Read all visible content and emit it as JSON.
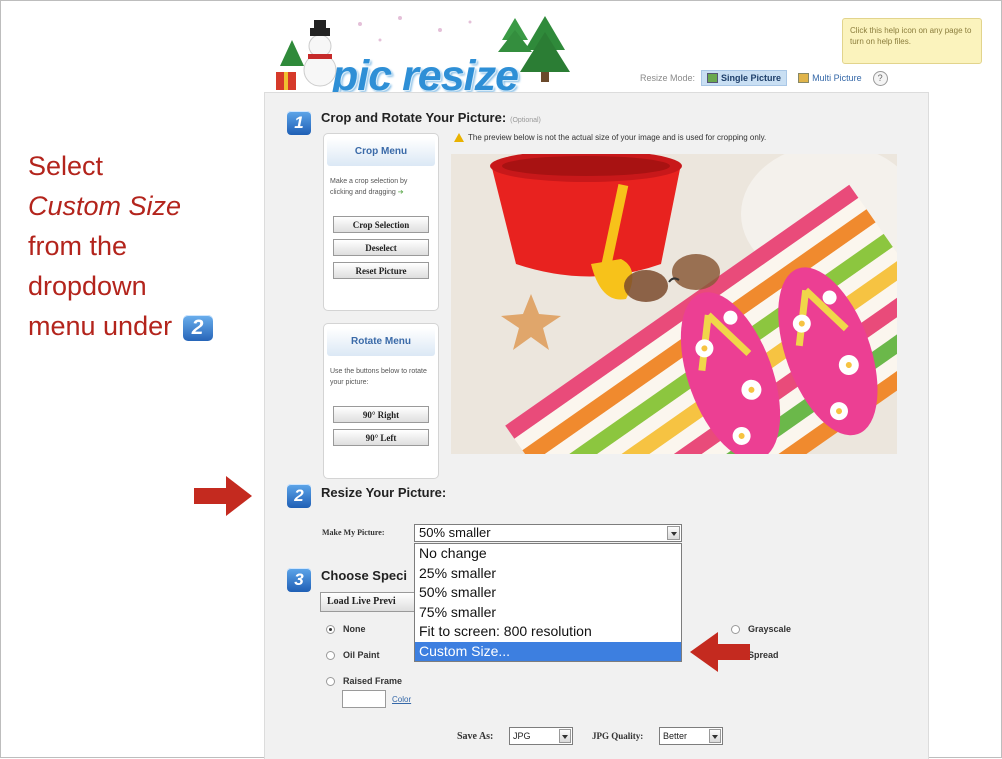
{
  "instruction": {
    "line1": "Select",
    "line2": "Custom Size",
    "line3": "from the",
    "line4": "dropdown",
    "line5": "menu under",
    "badge": "2"
  },
  "header": {
    "logo": "pic resize",
    "resize_mode_label": "Resize Mode:",
    "single_picture": "Single Picture",
    "multi_picture": "Multi Picture",
    "help_symbol": "?",
    "help_tip": "Click this help icon on any page to turn on help files."
  },
  "step1": {
    "number": "1",
    "title": "Crop and Rotate Your Picture:",
    "optional": "(Optional)",
    "warning": "The preview below is not the actual size of your image and is used for cropping only."
  },
  "crop_menu": {
    "title": "Crop Menu",
    "description": "Make a crop selection by clicking and dragging",
    "buttons": [
      "Crop Selection",
      "Deselect",
      "Reset Picture"
    ]
  },
  "rotate_menu": {
    "title": "Rotate Menu",
    "description": "Use the buttons below to rotate your picture:",
    "buttons": [
      "90° Right",
      "90° Left"
    ]
  },
  "step2": {
    "number": "2",
    "title": "Resize Your Picture:",
    "make_label": "Make My Picture:",
    "selected": "50% smaller",
    "options": [
      "No change",
      "25% smaller",
      "50% smaller",
      "75% smaller",
      "Fit to screen: 800 resolution",
      "Custom Size..."
    ],
    "highlighted": "Custom Size..."
  },
  "step3": {
    "number": "3",
    "title": "Choose Speci",
    "load_button": "Load Live Previ",
    "effects_left": [
      "None",
      "Oil Paint",
      "Raised Frame"
    ],
    "effects_right": [
      "Grayscale",
      "Spread"
    ],
    "color_link": "Color"
  },
  "save": {
    "save_as_label": "Save As:",
    "save_as_value": "JPG",
    "quality_label": "JPG Quality:",
    "quality_value": "Better"
  },
  "colors": {
    "instruction_red": "#b3241c",
    "arrow_red": "#c42a1f",
    "highlight_blue": "#3d7fe0",
    "accent_blue": "#2e8fd6"
  }
}
